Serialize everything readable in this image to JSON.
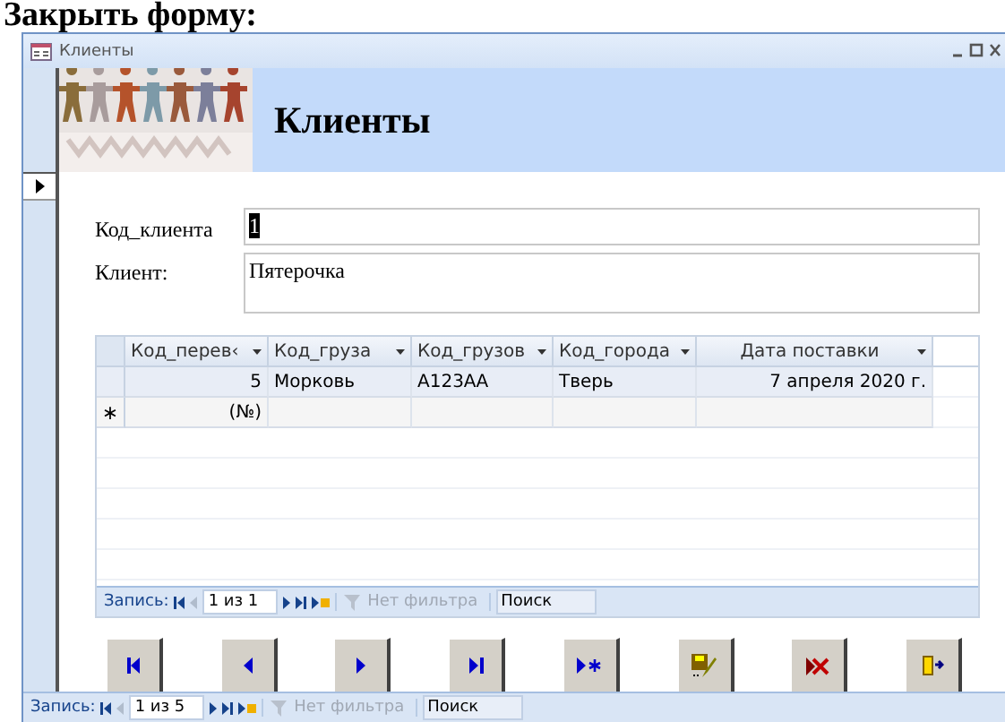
{
  "page_heading": "Закрыть форму:",
  "window": {
    "title": "Клиенты"
  },
  "header": {
    "title": "Клиенты"
  },
  "fields": [
    {
      "label": "Код_клиента",
      "value": "1",
      "selected": true,
      "kind": "line"
    },
    {
      "label": "Клиент:",
      "value": "Пятерочка",
      "selected": false,
      "kind": "memo"
    }
  ],
  "subform": {
    "columns": [
      {
        "label": "Код_перев‹"
      },
      {
        "label": "Код_груза"
      },
      {
        "label": "Код_грузов"
      },
      {
        "label": "Код_города"
      },
      {
        "label": "Дата поставки"
      }
    ],
    "rows": [
      [
        "5",
        "Морковь",
        "А123АА",
        "Тверь",
        "7 апреля 2020 г."
      ]
    ],
    "new_row": {
      "marker": "∗",
      "cells": [
        "(№)"
      ]
    },
    "navigation": {
      "label": "Запись:",
      "position": "1 из 1",
      "filter": "Нет фильтра",
      "search": "Поиск"
    }
  },
  "buttons": [
    {
      "kind": "first"
    },
    {
      "kind": "prev"
    },
    {
      "kind": "next"
    },
    {
      "kind": "last"
    },
    {
      "kind": "new"
    },
    {
      "kind": "save"
    },
    {
      "kind": "delete"
    },
    {
      "kind": "exit"
    }
  ],
  "navigation": {
    "label": "Запись:",
    "position": "1 из 5",
    "filter": "Нет фильтра",
    "search": "Поиск"
  }
}
